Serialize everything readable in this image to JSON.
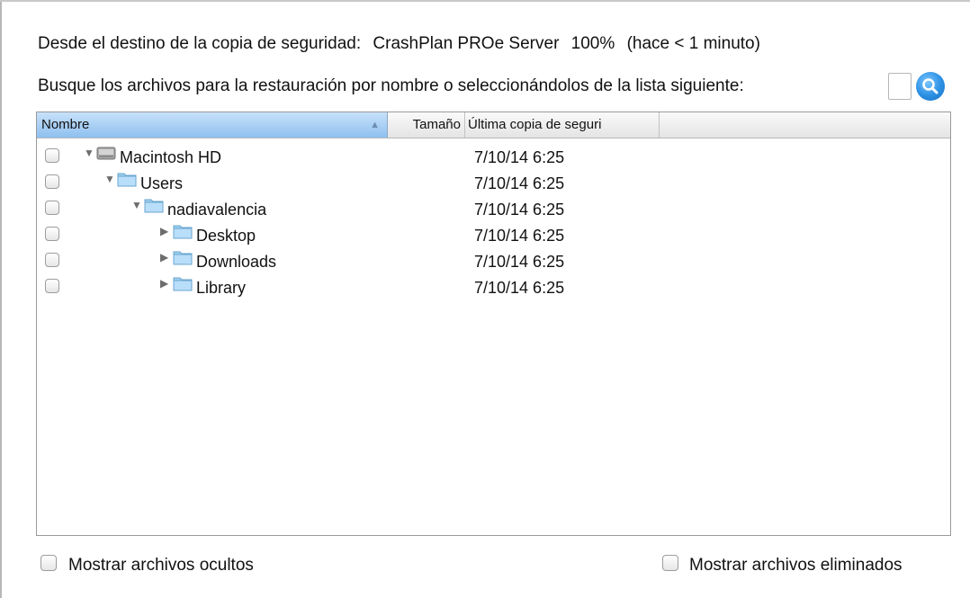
{
  "source": {
    "label": "Desde el destino de la copia de seguridad:",
    "destination": "CrashPlan PROe Server",
    "percent": "100%",
    "time": "(hace < 1 minuto)"
  },
  "search": {
    "prompt": "Busque los archivos para la restauración por nombre o seleccionándolos de la lista siguiente:",
    "value": "",
    "icon": "search-icon",
    "accent_color": "#2a8fe3"
  },
  "table": {
    "columns": {
      "name": "Nombre",
      "size": "Tamaño",
      "last_backup": "Última copia de seguri"
    },
    "sort": "ascending",
    "rows": [
      {
        "label": "Macintosh HD",
        "size": "",
        "date": "7/10/14 6:25",
        "icon": "hard-drive-icon",
        "expanded": true,
        "checked": false
      },
      {
        "label": "Users",
        "size": "",
        "date": "7/10/14 6:25",
        "icon": "folder-icon",
        "expanded": true,
        "checked": false
      },
      {
        "label": "nadiavalencia",
        "size": "",
        "date": "7/10/14 6:25",
        "icon": "folder-icon",
        "expanded": true,
        "checked": false
      },
      {
        "label": "Desktop",
        "size": "",
        "date": "7/10/14 6:25",
        "icon": "folder-icon",
        "expanded": false,
        "checked": false
      },
      {
        "label": "Downloads",
        "size": "",
        "date": "7/10/14 6:25",
        "icon": "folder-icon",
        "expanded": false,
        "checked": false
      },
      {
        "label": "Library",
        "size": "",
        "date": "7/10/14 6:25",
        "icon": "folder-icon",
        "expanded": false,
        "checked": false
      }
    ]
  },
  "options": {
    "show_hidden": "Mostrar archivos ocultos",
    "show_deleted": "Mostrar archivos eliminados"
  }
}
